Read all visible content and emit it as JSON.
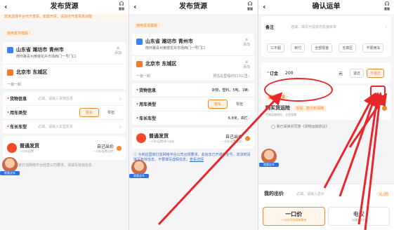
{
  "p1": {
    "title": "发布货源",
    "back": "‹",
    "service": "客服",
    "banner": "您未选择平台代开发票，如需开票，请前往开发票高功能",
    "template": "使用发货模版 ›",
    "from": {
      "city": "山东省 潍坊市 青州市",
      "detail": "南环路青州黄楼花卉市场西门一号门口"
    },
    "add_label": "添加",
    "to": {
      "city": "北京市 东城区"
    },
    "drive_section": "一装一卸",
    "cargo_label": "货物信息",
    "cargo_ph": "必填，请输入货物信息",
    "vehicle_label": "用车类型",
    "vehicle_opts": [
      "整车",
      "零担"
    ],
    "length_label": "车长车型",
    "length_ph": "必填，请输入车型车长",
    "ship_type": "普通发货",
    "ship_sub": "一口价运费",
    "bid_label": "自己出价",
    "bid_sub": "一口价运费/议价",
    "avatar": "就要这车",
    "footer": "为响应国家打造网络平台经营公司要求，请填写有效信息"
  },
  "p2": {
    "title": "发布货源",
    "back": "‹",
    "service": "客服",
    "template": "使用发货模版 ›",
    "from": {
      "city": "山东省 潍坊市 青州市",
      "detail": "南环路青州黄楼花卉市场西门一号门口"
    },
    "to": {
      "city": "北京市 东城区"
    },
    "add_label": "添加",
    "drive_section": "一装一卸",
    "distance": "预估总里程约513公里",
    "cargo_label": "货物信息",
    "cargo_value": "杂物，塑料，5吨，1辆",
    "vehicle_label": "用车类型",
    "vehicle_opts": [
      "整车",
      "零担"
    ],
    "length_label": "车长车型",
    "length_value": "6.8米，高栏",
    "ship_type": "普通发货",
    "ship_sub": "一口价运费/车+议价",
    "bid_label": "自己出价",
    "bid_sub": "一口价运费/议价",
    "avatar": "就要这车",
    "footer_note": "为响应国家打造网络平台公司合规要求，此信息已开通安全号，发货时请填写有效信息，不要填写虚假信息；",
    "footer_link": "查看详情"
  },
  "p3": {
    "title": "确认运单",
    "back": "‹",
    "service": "客服",
    "remark_label": "备注",
    "remark_ph": "选填，填写可提高司机接单率",
    "pills": [
      "三不超",
      "到付",
      "全部现金",
      "无禁区",
      "不限用车"
    ],
    "deposit_label": "订金",
    "deposit_value": "200",
    "unit": "元",
    "refund": "退还",
    "no_refund": "不退还",
    "service_req": "服务要求",
    "insurance_title": "购买货运险",
    "insurance_tag": "省钱，赔付有保障",
    "insurance_detail": "货物运输保险，全程保障",
    "agreement": "我已阅读并同意《货物运输协议》",
    "my_bid": "我的出价",
    "bid_ph": "必填，请输入总价",
    "bid_unit": "元/趟",
    "one_price": "一口价",
    "one_price_sub": "一口价司机接单更快",
    "negotiate": "电议",
    "negotiate_sub": "沟通后定价",
    "avatar": "就要这车"
  },
  "colors": {
    "accent": "#f28a2c",
    "annotation": "#e8262b",
    "blue": "#3b82f6"
  }
}
